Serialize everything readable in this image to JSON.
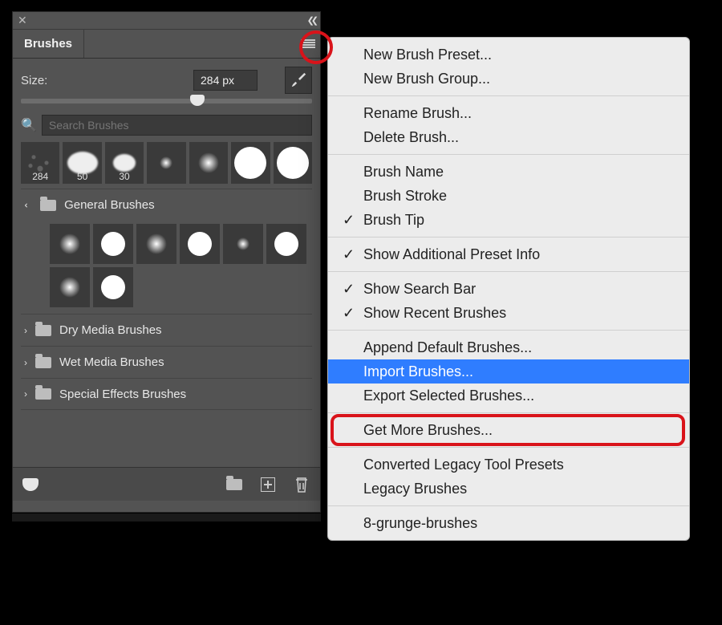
{
  "panel": {
    "title": "Brushes",
    "size_label": "Size:",
    "size_value": "284 px",
    "search_placeholder": "Search Brushes",
    "recent": [
      {
        "label": "284"
      },
      {
        "label": "50"
      },
      {
        "label": "30"
      },
      {
        "label": ""
      },
      {
        "label": ""
      },
      {
        "label": ""
      },
      {
        "label": ""
      }
    ],
    "folders": {
      "general": "General Brushes",
      "dry": "Dry Media Brushes",
      "wet": "Wet Media Brushes",
      "fx": "Special Effects Brushes"
    }
  },
  "menu": {
    "new_preset": "New Brush Preset...",
    "new_group": "New Brush Group...",
    "rename": "Rename Brush...",
    "delete": "Delete Brush...",
    "brush_name": "Brush Name",
    "brush_stroke": "Brush Stroke",
    "brush_tip": "Brush Tip",
    "show_info": "Show Additional Preset Info",
    "show_search": "Show Search Bar",
    "show_recent": "Show Recent Brushes",
    "append": "Append Default Brushes...",
    "import": "Import Brushes...",
    "export": "Export Selected Brushes...",
    "get_more": "Get More Brushes...",
    "converted": "Converted Legacy Tool Presets",
    "legacy": "Legacy Brushes",
    "grunge": "8-grunge-brushes"
  }
}
